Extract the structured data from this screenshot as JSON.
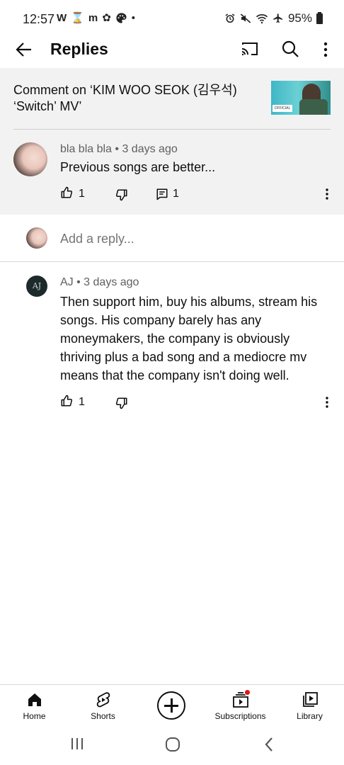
{
  "status_bar": {
    "time": "12:57",
    "left_icons": [
      "W",
      "⌛",
      "m",
      "✿",
      "palette-icon",
      "•"
    ],
    "battery": "95%"
  },
  "header": {
    "title": "Replies"
  },
  "context": {
    "label": "Comment on ‘KIM WOO SEOK (김우석) ‘Switch’ MV’",
    "thumb_logo": "OFFICIAL"
  },
  "parent_comment": {
    "author": "bla bla bla",
    "age": "3 days ago",
    "text": "Previous songs are better...",
    "likes": "1",
    "replies": "1"
  },
  "add_reply": {
    "placeholder": "Add a reply..."
  },
  "reply": {
    "avatar_text": "AJ",
    "author": "AJ",
    "age": "3 days ago",
    "text": "Then support him, buy his albums, stream his songs. His company barely has any moneymakers, the company is obviously thriving plus a bad song and a mediocre mv means that the company isn't doing well.",
    "likes": "1"
  },
  "bottom_nav": {
    "home": "Home",
    "shorts": "Shorts",
    "subscriptions": "Subscriptions",
    "library": "Library"
  },
  "colors": {
    "accent_red": "#e21212",
    "meta_gray": "#606060",
    "panel_bg": "#f2f2f2"
  }
}
